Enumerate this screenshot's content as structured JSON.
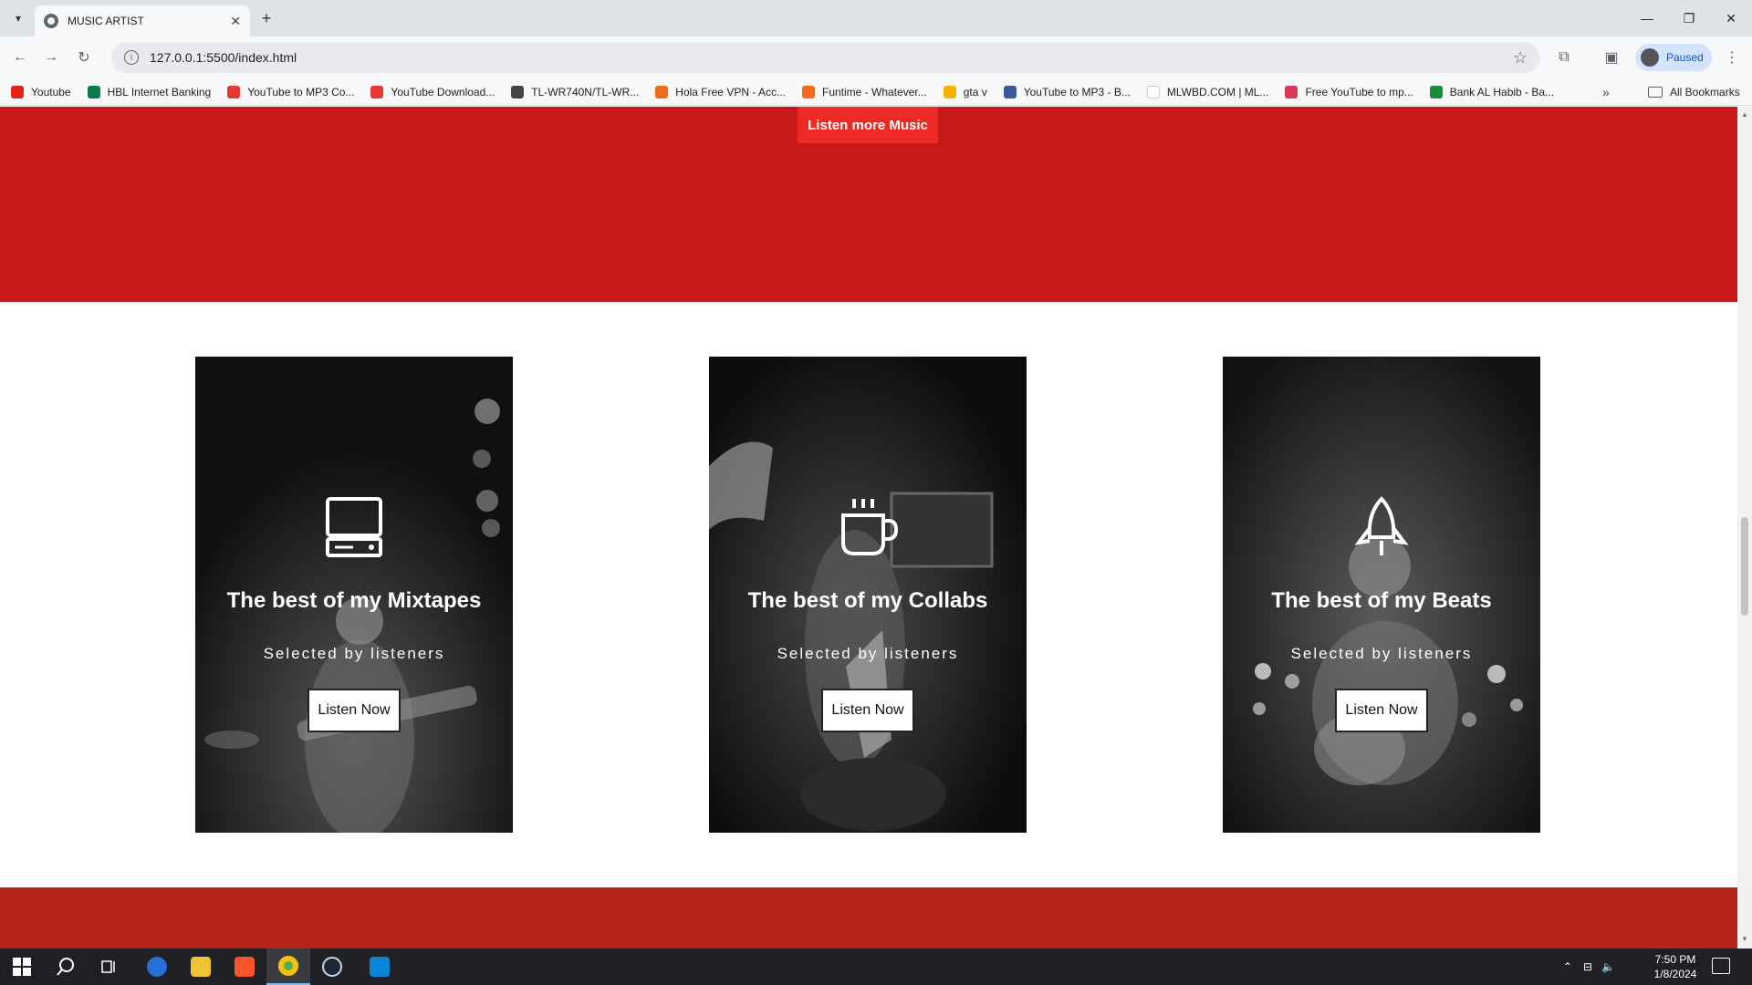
{
  "browser": {
    "tab_title": "MUSIC ARTIST",
    "url": "127.0.0.1:5500/index.html",
    "profile_label": "Paused"
  },
  "bookmarks": [
    {
      "label": "Youtube",
      "color": "#e62117"
    },
    {
      "label": "HBL Internet Banking",
      "color": "#0a7a4a"
    },
    {
      "label": "YouTube to MP3 Co...",
      "color": "#e53935"
    },
    {
      "label": "YouTube Download...",
      "color": "#e53935"
    },
    {
      "label": "TL-WR740N/TL-WR...",
      "color": "#444444"
    },
    {
      "label": "Hola Free VPN - Acc...",
      "color": "#f26b1d"
    },
    {
      "label": "Funtime - Whatever...",
      "color": "#f26b1d"
    },
    {
      "label": "gta v",
      "color": "#f5b400"
    },
    {
      "label": "YouTube to MP3 - B...",
      "color": "#3b5998"
    },
    {
      "label": "MLWBD.COM | ML...",
      "color": "#ffffff"
    },
    {
      "label": "Free YouTube to mp...",
      "color": "#d93a5a"
    },
    {
      "label": "Bank AL Habib - Ba...",
      "color": "#1b8a3c"
    }
  ],
  "bookmarks_all": "All Bookmarks",
  "page": {
    "listen_more_label": "Listen more Music",
    "hero_color": "#c8191a",
    "cards": [
      {
        "icon": "computer-icon",
        "title": "The best of my Mixtapes",
        "subtitle": "Selected by listeners",
        "button": "Listen Now"
      },
      {
        "icon": "coffee-cup-icon",
        "title": "The best of my Collabs",
        "subtitle": "Selected by listeners",
        "button": "Listen Now"
      },
      {
        "icon": "rocket-icon",
        "title": "The best of my Beats",
        "subtitle": "Selected by listeners",
        "button": "Listen Now"
      }
    ]
  },
  "taskbar": {
    "time": "7:50 PM",
    "date": "1/8/2024"
  }
}
